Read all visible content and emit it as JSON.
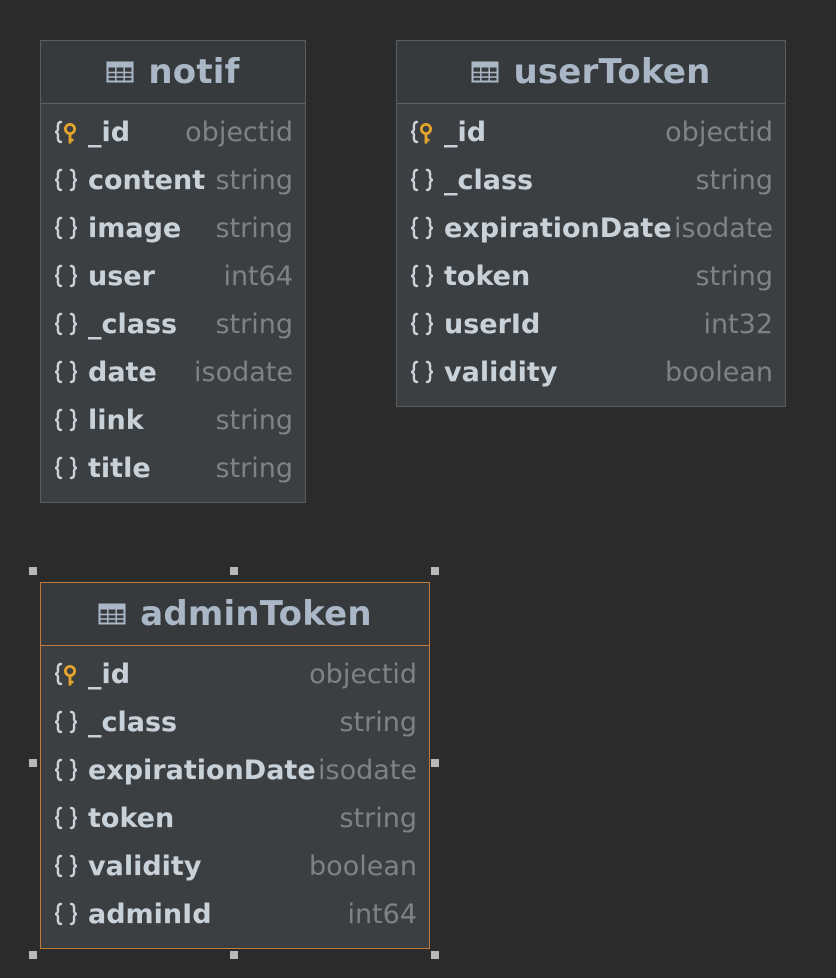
{
  "entities": [
    {
      "id": "notif",
      "name": "notif",
      "selected": false,
      "fields": [
        {
          "name": "_id",
          "type": "objectid",
          "key": true
        },
        {
          "name": "content",
          "type": "string",
          "key": false
        },
        {
          "name": "image",
          "type": "string",
          "key": false
        },
        {
          "name": "user",
          "type": "int64",
          "key": false
        },
        {
          "name": "_class",
          "type": "string",
          "key": false
        },
        {
          "name": "date",
          "type": "isodate",
          "key": false
        },
        {
          "name": "link",
          "type": "string",
          "key": false
        },
        {
          "name": "title",
          "type": "string",
          "key": false
        }
      ]
    },
    {
      "id": "userToken",
      "name": "userToken",
      "selected": false,
      "fields": [
        {
          "name": "_id",
          "type": "objectid",
          "key": true
        },
        {
          "name": "_class",
          "type": "string",
          "key": false
        },
        {
          "name": "expirationDate",
          "type": "isodate",
          "key": false
        },
        {
          "name": "token",
          "type": "string",
          "key": false
        },
        {
          "name": "userId",
          "type": "int32",
          "key": false
        },
        {
          "name": "validity",
          "type": "boolean",
          "key": false
        }
      ]
    },
    {
      "id": "adminToken",
      "name": "adminToken",
      "selected": true,
      "fields": [
        {
          "name": "_id",
          "type": "objectid",
          "key": true
        },
        {
          "name": "_class",
          "type": "string",
          "key": false
        },
        {
          "name": "expirationDate",
          "type": "isodate",
          "key": false
        },
        {
          "name": "token",
          "type": "string",
          "key": false
        },
        {
          "name": "validity",
          "type": "boolean",
          "key": false
        },
        {
          "name": "adminId",
          "type": "int64",
          "key": false
        }
      ]
    }
  ],
  "icons": {
    "table": "table-icon",
    "field": "braces-icon",
    "key": "key-icon"
  },
  "colors": {
    "background": "#2b2b2b",
    "entity_fill": "#3c3f41",
    "selection": "#c27a3a",
    "key": "#e5a42c"
  }
}
